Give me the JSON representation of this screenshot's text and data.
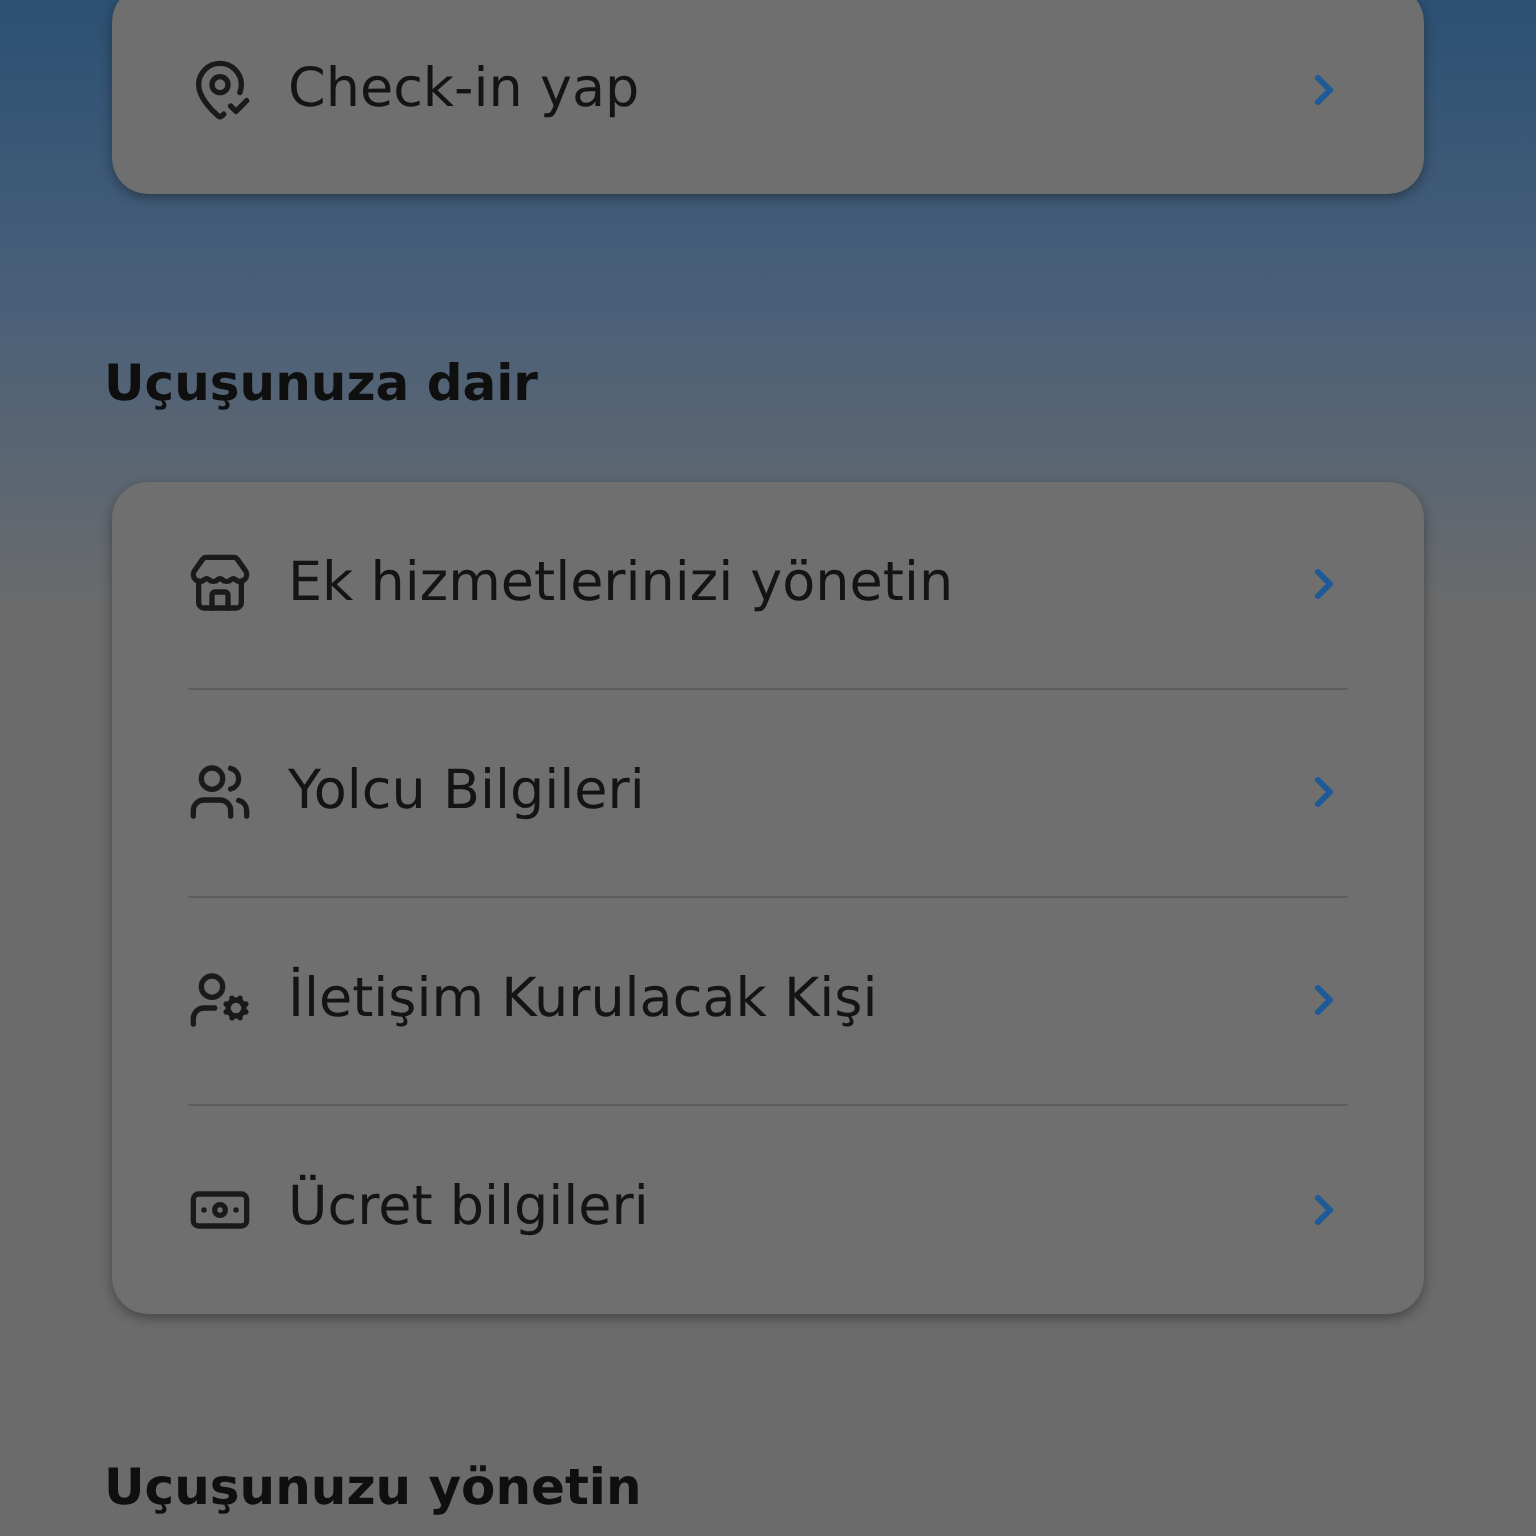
{
  "top_card": {
    "items": [
      {
        "label": "Check-in yap"
      }
    ]
  },
  "sections": [
    {
      "heading": "Uçuşunuza dair",
      "items": [
        {
          "label": "Ek hizmetlerinizi yönetin"
        },
        {
          "label": "Yolcu Bilgileri"
        },
        {
          "label": "İletişim Kurulacak Kişi"
        },
        {
          "label": "Ücret bilgileri"
        }
      ]
    },
    {
      "heading": "Uçuşunuzu yönetin"
    }
  ]
}
